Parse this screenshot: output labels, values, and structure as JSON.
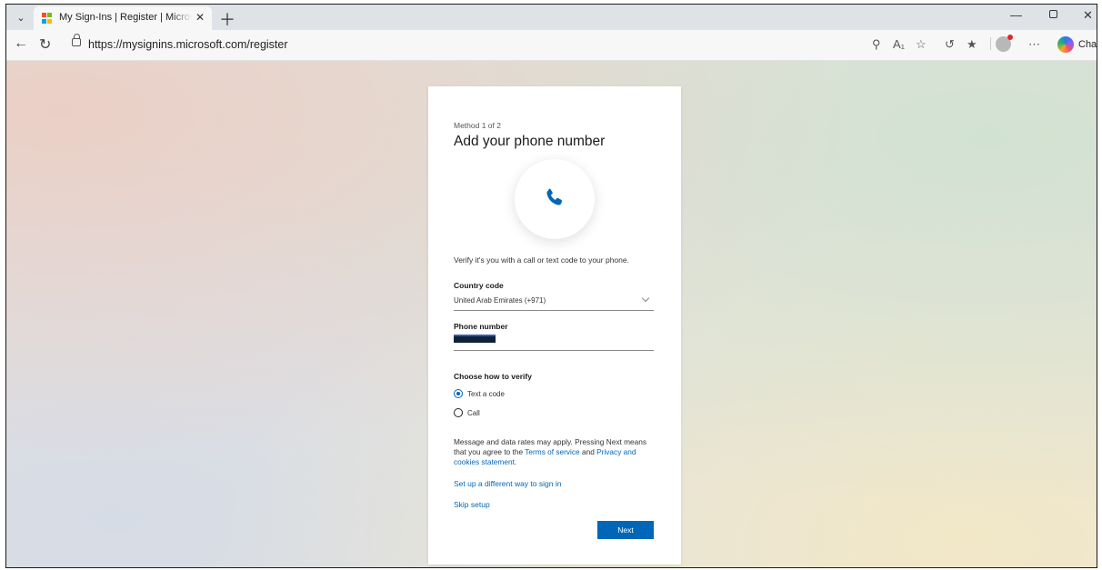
{
  "browser": {
    "tab_title": "My Sign-Ins | Register | Microsoft",
    "tab_close_icon": "close-icon",
    "new_tab_icon": "plus-icon",
    "url": "https://mysignins.microsoft.com/register",
    "chat_label": "Chat",
    "window_controls": [
      "minimize-icon",
      "restore-icon",
      "close-icon"
    ],
    "toolbar_icons": [
      "zoom-icon",
      "read-aloud-icon",
      "favorite-star-icon",
      "extensions-icon",
      "favorites-icon",
      "profile-icon",
      "more-icon",
      "copilot-icon"
    ]
  },
  "colors": {
    "accent": "#0067b8",
    "ms_logo": [
      "#f25022",
      "#7fba00",
      "#00a4ef",
      "#ffb900"
    ]
  },
  "card": {
    "method_step": "Method 1 of 2",
    "title": "Add your phone number",
    "icon": "phone-icon",
    "intro": "Verify it's you with a call or text code to your phone.",
    "country_label": "Country code",
    "country_value": "United Arab Emirates (+971)",
    "phone_label": "Phone number",
    "verify_label": "Choose how to verify",
    "options": [
      {
        "label": "Text a code",
        "selected": true
      },
      {
        "label": "Call",
        "selected": false
      }
    ],
    "disclaimer_pre": "Message and data rates may apply. Pressing Next means that you agree to the ",
    "terms_link": "Terms of service",
    "disclaimer_mid": " and ",
    "privacy_link": "Privacy and cookies statement",
    "disclaimer_post": ".",
    "different_way_link": "Set up a different way to sign in",
    "skip_link": "Skip setup",
    "next_label": "Next"
  }
}
